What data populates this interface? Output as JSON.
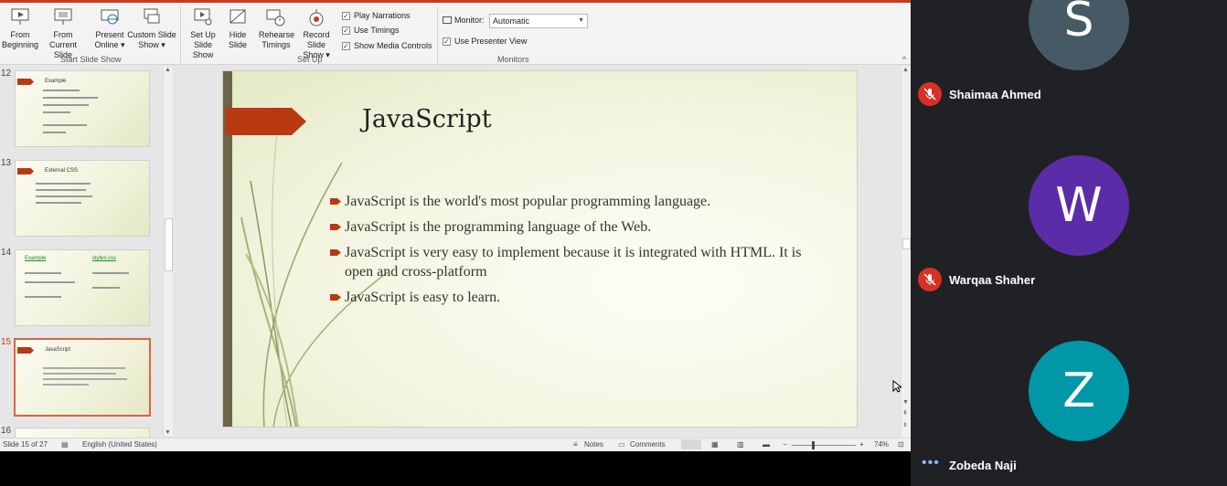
{
  "ribbon": {
    "start_group": "Start Slide Show",
    "setup_group": "Set Up",
    "monitors_group": "Monitors",
    "buttons": {
      "from_beginning": [
        "From",
        "Beginning"
      ],
      "from_current": [
        "From",
        "Current Slide"
      ],
      "present_online": [
        "Present",
        "Online ▾"
      ],
      "custom_show": [
        "Custom Slide",
        "Show ▾"
      ],
      "setup_show": [
        "Set Up",
        "Slide Show"
      ],
      "hide_slide": [
        "Hide",
        "Slide"
      ],
      "rehearse": [
        "Rehearse",
        "Timings"
      ],
      "record": [
        "Record Slide",
        "Show ▾"
      ]
    },
    "checks": {
      "play_narrations": "Play Narrations",
      "use_timings": "Use Timings",
      "show_media": "Show Media Controls",
      "use_presenter": "Use Presenter View"
    },
    "monitor_label": "Monitor:",
    "monitor_value": "Automatic"
  },
  "thumbnails": [
    {
      "num": "12",
      "title": "Example"
    },
    {
      "num": "13",
      "title": "External CSS"
    },
    {
      "num": "14",
      "title": "Example",
      "title2": "styles.css"
    },
    {
      "num": "15",
      "title": "JavaScript"
    },
    {
      "num": "16",
      "title": ""
    }
  ],
  "slide": {
    "title": "JavaScript",
    "bullets": [
      "JavaScript is the world's most popular programming language.",
      "JavaScript is the programming language of the Web.",
      "JavaScript is very easy to implement because it is integrated with HTML. It is open and cross-platform",
      "JavaScript is easy to learn."
    ]
  },
  "status": {
    "slide_info": "Slide 15 of 27",
    "language": "English (United States)",
    "notes": "Notes",
    "comments": "Comments",
    "zoom_minus": "−",
    "zoom_plus": "+",
    "zoom": "74%"
  },
  "participants": [
    {
      "initial": "S",
      "name": "Shaimaa Ahmed",
      "color": "#455a64",
      "muted": true
    },
    {
      "initial": "W",
      "name": "Warqaa Shaher",
      "color": "#5b2ca8",
      "muted": true
    },
    {
      "initial": "Z",
      "name": "Zobeda Naji",
      "color": "#0097a7",
      "muted": false
    }
  ],
  "more_label": "•••"
}
